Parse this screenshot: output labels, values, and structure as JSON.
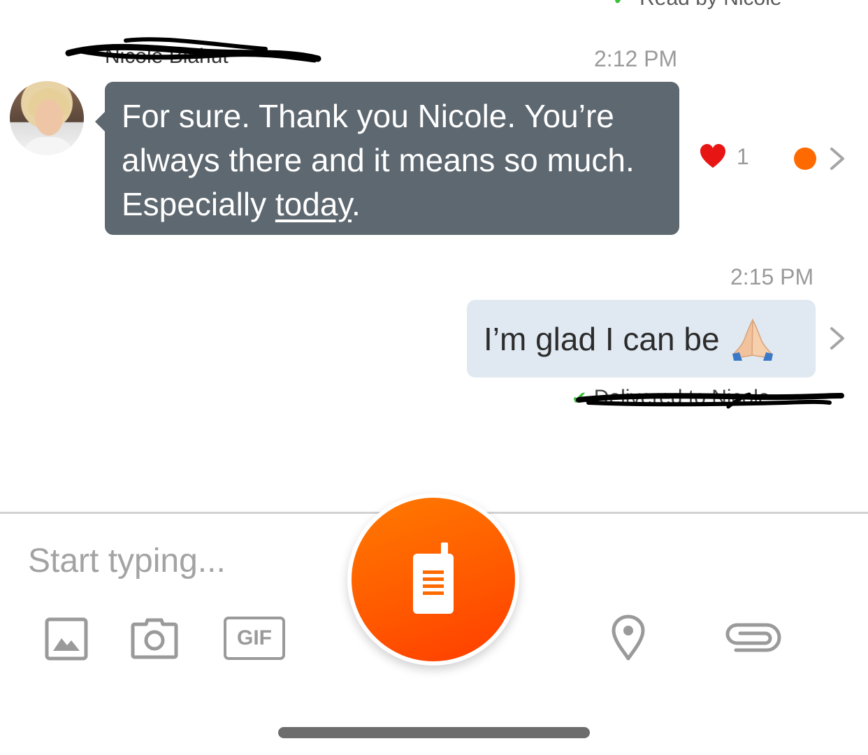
{
  "conversation": {
    "read_receipt": "Read by Nicole",
    "sender_name": "Nicole Blahut",
    "incoming": {
      "time": "2:12 PM",
      "text_before_link": "For sure. Thank you Nicole. You’re always there and it means so much. Especially ",
      "link_text": "today",
      "text_after_link": ".",
      "reaction_count": "1"
    },
    "outgoing": {
      "time": "2:15 PM",
      "text": "I’m glad I can be",
      "delivered": "Delivered to Nicole"
    }
  },
  "composer": {
    "placeholder": "Start typing...",
    "gif_label": "GIF",
    "accent_color": "#ff6a00"
  },
  "icons": [
    "check-icon",
    "heart-icon",
    "chevron-right-icon",
    "praying-hands-icon",
    "photo-icon",
    "camera-icon",
    "gif-icon",
    "walkie-talkie-icon",
    "location-pin-icon",
    "paperclip-icon"
  ]
}
